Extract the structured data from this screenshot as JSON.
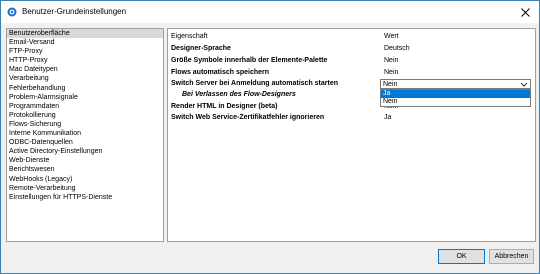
{
  "window": {
    "title": "Benutzer-Grundeinstellungen",
    "close_glyph": "✕"
  },
  "sidebar": {
    "items": [
      {
        "label": "Benutzeroberfläche",
        "selected": true
      },
      {
        "label": "Email-Versand"
      },
      {
        "label": "FTP-Proxy"
      },
      {
        "label": "HTTP-Proxy"
      },
      {
        "label": "Mac Dateitypen"
      },
      {
        "label": "Verarbeitung"
      },
      {
        "label": "Fehlerbehandlung"
      },
      {
        "label": "Problem-Alarmsignale"
      },
      {
        "label": "Programmdaten"
      },
      {
        "label": "Protokollierung"
      },
      {
        "label": "Flows-Sicherung"
      },
      {
        "label": "Interne Kommunikation"
      },
      {
        "label": "ODBC-Datenquellen"
      },
      {
        "label": "Active Directory-Einstellungen"
      },
      {
        "label": "Web-Dienste"
      },
      {
        "label": "Berichtswesen"
      },
      {
        "label": "WebHooks (Legacy)"
      },
      {
        "label": "Remote-Verarbeitung"
      },
      {
        "label": "Einstellungen für HTTPS-Dienste"
      }
    ]
  },
  "properties": {
    "header_property": "Eigenschaft",
    "header_value": "Wert",
    "rows": [
      {
        "name": "Designer-Sprache",
        "value": "Deutsch"
      },
      {
        "name": "Größe Symbole innerhalb der Elemente-Palette",
        "value": "Nein"
      },
      {
        "name": "Flows automatisch speichern",
        "value": "Nein"
      },
      {
        "name": "Switch Server bei Anmeldung automatisch starten",
        "value": "Nein"
      },
      {
        "name": "Bei Verlassen des Flow-Designers",
        "value": ""
      },
      {
        "name": "Render HTML in Designer (beta)",
        "value": "Nein"
      },
      {
        "name": "Switch Web Service-Zertifikatfehler ignorieren",
        "value": "Ja"
      }
    ]
  },
  "dropdown": {
    "value": "Nein",
    "options": [
      "Ja",
      "Nein"
    ],
    "highlighted": "Ja"
  },
  "buttons": {
    "ok": "OK",
    "cancel": "Abbrechen"
  },
  "colors": {
    "accent": "#0078d7",
    "border": "#3c7fb1"
  }
}
